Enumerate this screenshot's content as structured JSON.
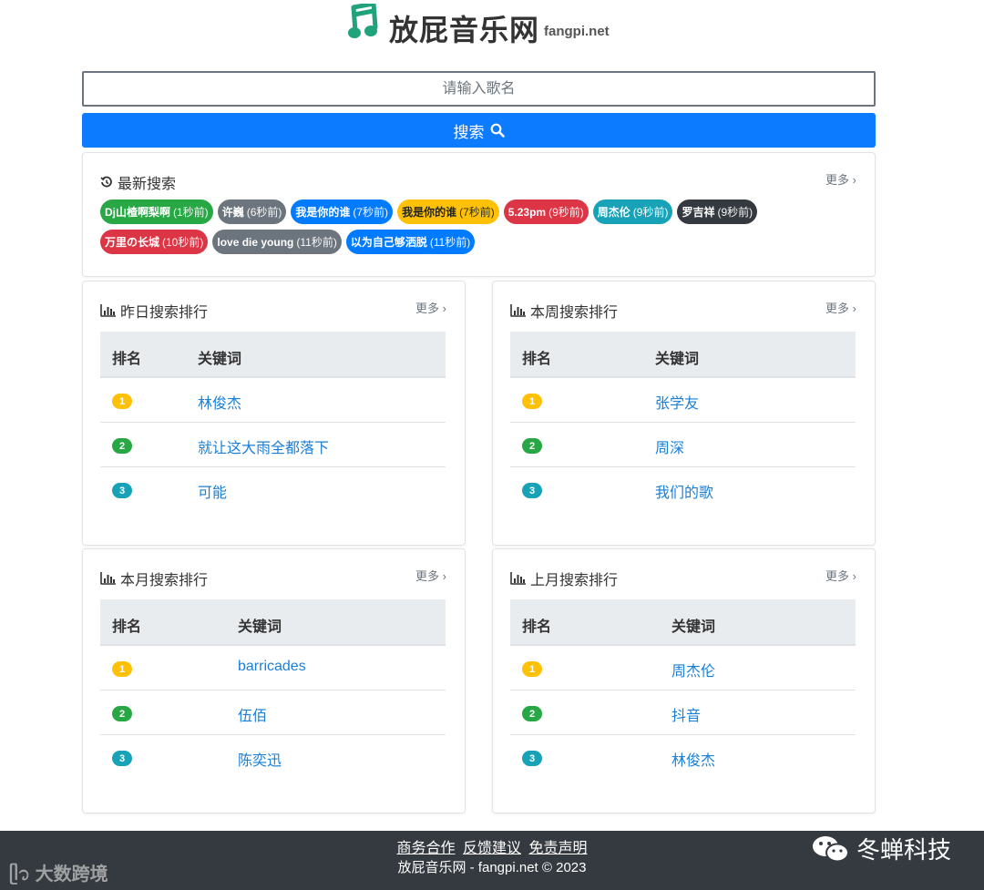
{
  "header": {
    "site_name": "放屁音乐网",
    "site_domain": "fangpi.net"
  },
  "search": {
    "placeholder": "请输入歌名",
    "button_label": "搜索"
  },
  "recent": {
    "title": "最新搜索",
    "more": "更多",
    "items": [
      {
        "keyword": "Dj山楂啊梨啊",
        "time": "(1秒前)",
        "color": "#28a745"
      },
      {
        "keyword": "许巍",
        "time": "(6秒前)",
        "color": "#6c757d"
      },
      {
        "keyword": "我是你的谁",
        "time": "(7秒前)",
        "color": "#007bff"
      },
      {
        "keyword": "我是你的谁",
        "time": "(7秒前)",
        "color": "#ffc107"
      },
      {
        "keyword": "5.23pm",
        "time": "(9秒前)",
        "color": "#dc3545"
      },
      {
        "keyword": "周杰伦",
        "time": "(9秒前)",
        "color": "#17a2b8"
      },
      {
        "keyword": "罗吉祥",
        "time": "(9秒前)",
        "color": "#343a40"
      },
      {
        "keyword": "万里の长城",
        "time": "(10秒前)",
        "color": "#dc3545"
      },
      {
        "keyword": "love die young",
        "time": "(11秒前)",
        "color": "#6c757d"
      },
      {
        "keyword": "以为自己够洒脱",
        "time": "(11秒前)",
        "color": "#007bff"
      }
    ]
  },
  "rankings": [
    {
      "title": "昨日搜索排行",
      "more": "更多",
      "col_rank": "排名",
      "col_keyword": "关键词",
      "rows": [
        {
          "rank": "1",
          "keyword": "林俊杰"
        },
        {
          "rank": "2",
          "keyword": "就让这大雨全都落下"
        },
        {
          "rank": "3",
          "keyword": "可能"
        }
      ]
    },
    {
      "title": "本周搜索排行",
      "more": "更多",
      "col_rank": "排名",
      "col_keyword": "关键词",
      "rows": [
        {
          "rank": "1",
          "keyword": "张学友"
        },
        {
          "rank": "2",
          "keyword": "周深"
        },
        {
          "rank": "3",
          "keyword": "我们的歌"
        }
      ]
    },
    {
      "title": "本月搜索排行",
      "more": "更多",
      "col_rank": "排名",
      "col_keyword": "关键词",
      "rows": [
        {
          "rank": "1",
          "keyword": "barricades"
        },
        {
          "rank": "2",
          "keyword": "伍佰"
        },
        {
          "rank": "3",
          "keyword": "陈奕迅"
        }
      ]
    },
    {
      "title": "上月搜索排行",
      "more": "更多",
      "col_rank": "排名",
      "col_keyword": "关键词",
      "rows": [
        {
          "rank": "1",
          "keyword": "周杰伦"
        },
        {
          "rank": "2",
          "keyword": "抖音"
        },
        {
          "rank": "3",
          "keyword": "林俊杰"
        }
      ]
    }
  ],
  "rank_colors": {
    "1": "#ffc107",
    "2": "#28a745",
    "3": "#17a2b8"
  },
  "footer": {
    "links": [
      "商务合作",
      "反馈建议",
      "免责声明"
    ],
    "copyright": "放屁音乐网 - fangpi.net © 2023"
  },
  "watermarks": {
    "left": "大数跨境",
    "right": "冬蝉科技"
  }
}
